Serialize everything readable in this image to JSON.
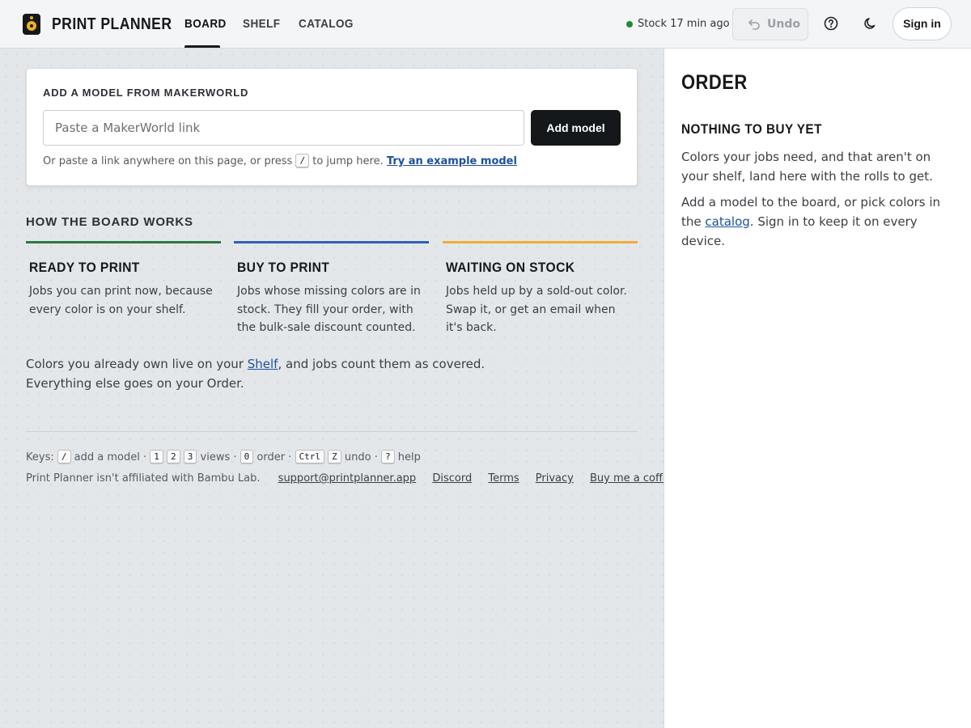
{
  "header": {
    "brand": "PRINT PLANNER",
    "tabs": [
      {
        "label": "BOARD",
        "active": true
      },
      {
        "label": "SHELF",
        "active": false
      },
      {
        "label": "CATALOG",
        "active": false
      }
    ],
    "stock_status": "Stock 17 min ago",
    "undo_label": "Undo",
    "signin_label": "Sign in"
  },
  "add_model": {
    "title": "ADD A MODEL FROM MAKERWORLD",
    "input_placeholder": "Paste a MakerWorld link",
    "input_value": "",
    "button_label": "Add model",
    "hint_before": "Or paste a link anywhere on this page, or press",
    "hint_key": "/",
    "hint_after": "to jump here.",
    "example_link": "Try an example model"
  },
  "how": {
    "title": "HOW THE BOARD WORKS",
    "columns": [
      {
        "title": "READY TO PRINT",
        "desc": "Jobs you can print now, because every color is on your shelf."
      },
      {
        "title": "BUY TO PRINT",
        "desc": "Jobs whose missing colors are in stock. They fill your order, with the bulk-sale discount counted."
      },
      {
        "title": "WAITING ON STOCK",
        "desc": "Jobs held up by a sold-out color. Swap it, or get an email when it's back."
      }
    ],
    "summary_before": "Colors you already own live on your",
    "summary_link": "Shelf",
    "summary_after": ", and jobs count them as covered. Everything else goes on your Order."
  },
  "keys": {
    "label": "Keys:",
    "k_slash": "/",
    "t_add": "add a model ·",
    "k1": "1",
    "k2": "2",
    "k3": "3",
    "t_views": "views ·",
    "k0": "0",
    "t_order": "order ·",
    "kctrl": "Ctrl",
    "kz": "Z",
    "t_undo": "undo ·",
    "kq": "?",
    "t_help": "help"
  },
  "footer": {
    "disclaimer": "Print Planner isn't affiliated with Bambu Lab.",
    "links": [
      "support@printplanner.app",
      "Discord",
      "Terms",
      "Privacy",
      "Buy me a coffee"
    ]
  },
  "order": {
    "title": "ORDER",
    "subtitle": "NOTHING TO BUY YET",
    "p1": "Colors your jobs need, and that aren't on your shelf, land here with the rolls to get.",
    "p2_before": "Add a model to the board, or pick colors in the",
    "p2_link": "catalog",
    "p2_after": ". Sign in to keep it on every device."
  },
  "colors": {
    "ready": "#2a7a3e",
    "buy": "#2f5fb8",
    "waiting": "#f0ac38",
    "stock_dot": "#1f8a3c"
  },
  "icons": [
    "logo-icon",
    "undo-icon",
    "help-icon",
    "moon-icon"
  ]
}
